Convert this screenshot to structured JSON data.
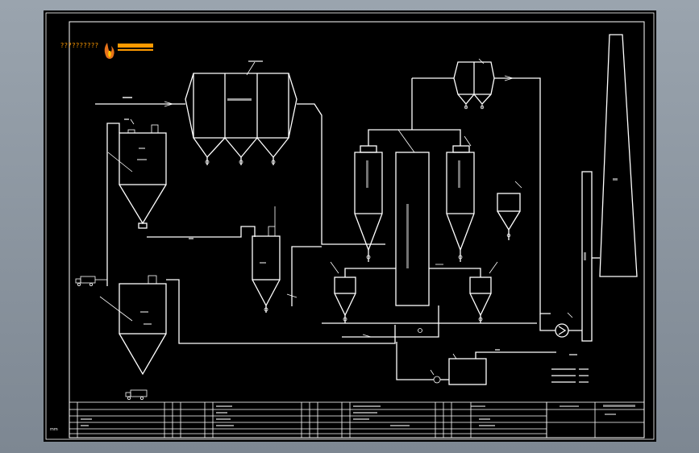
{
  "logo": {
    "caption": "??????????",
    "icon": "flame-logo-icon"
  },
  "drawing_footer_code": "mm"
}
